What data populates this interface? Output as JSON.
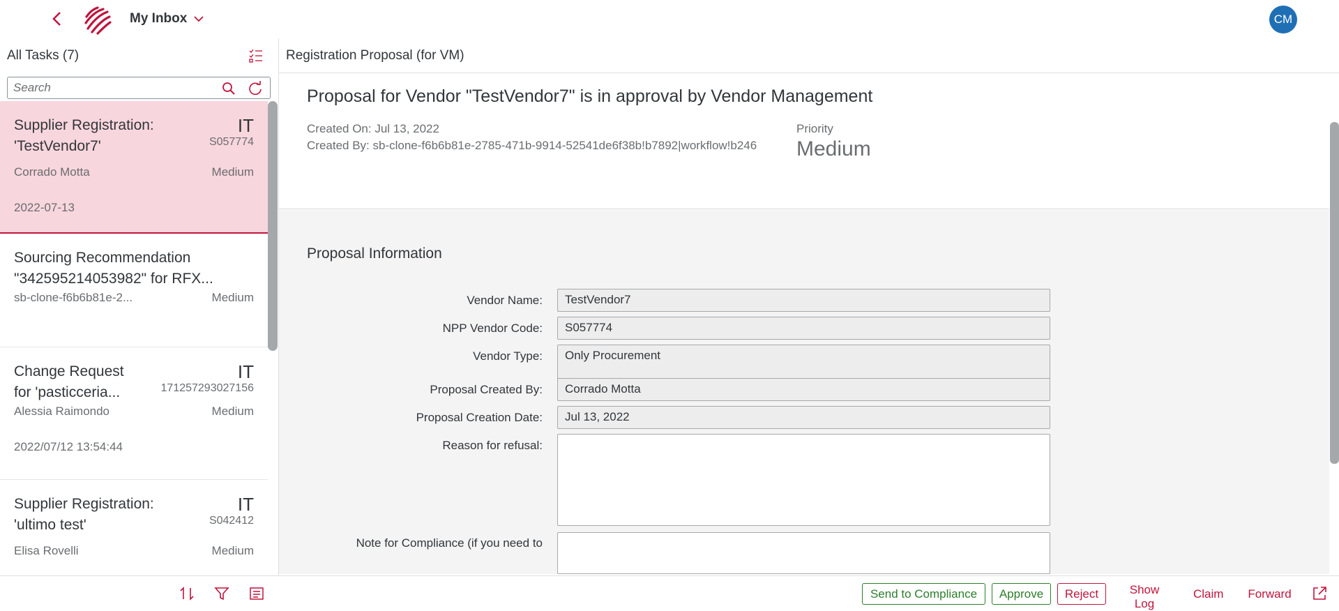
{
  "shell": {
    "title": "My Inbox",
    "avatar_initials": "CM",
    "accent_color": "#c0143c",
    "avatar_color": "#1f6fb5"
  },
  "master": {
    "title": "All Tasks (7)",
    "search_placeholder": "Search",
    "items": [
      {
        "title": "Supplier Registration: 'TestVendor7'",
        "number": "IT",
        "unit": "S057774",
        "attribute": "Corrado Motta",
        "status": "Medium",
        "date": "2022-07-13",
        "selected": true
      },
      {
        "title": "Sourcing Recommendation \"342595214053982\" for RFX...",
        "number": "",
        "unit": "",
        "attribute": "sb-clone-f6b6b81e-2...",
        "status": "Medium",
        "date": ""
      },
      {
        "title": "Change Request for 'pasticceria...",
        "number": "IT",
        "unit": "171257293027156",
        "attribute": "Alessia Raimondo",
        "status": "Medium",
        "date": "2022/07/12 13:54:44"
      },
      {
        "title": "Supplier Registration: 'ultimo test'",
        "number": "IT",
        "unit": "S042412",
        "attribute": "Elisa Rovelli",
        "status": "Medium",
        "date": ""
      }
    ],
    "footer_icons": [
      "sort-icon",
      "filter-icon",
      "group-icon"
    ]
  },
  "detail": {
    "title": "Registration Proposal (for VM)",
    "object_title": "Proposal for Vendor \"TestVendor7\" is in approval by Vendor Management",
    "created_on": "Created On: Jul 13, 2022",
    "created_by": "Created By: sb-clone-f6b6b81e-2785-471b-9914-52541de6f38b!b7892|workflow!b246",
    "priority_label": "Priority",
    "priority_value": "Medium",
    "section_title": "Proposal Information",
    "fields": [
      {
        "label": "Vendor Name:",
        "value": "TestVendor7"
      },
      {
        "label": "NPP Vendor Code:",
        "value": "S057774"
      },
      {
        "label": "Vendor Type:",
        "value": "Only Procurement"
      },
      {
        "label": "Proposal Created By:",
        "value": "Corrado Motta"
      },
      {
        "label": "Proposal Creation Date:",
        "value": "Jul 13, 2022"
      },
      {
        "label": "Reason for refusal:",
        "value": ""
      },
      {
        "label": "Note for Compliance (if you need to",
        "value": ""
      }
    ],
    "actions": {
      "send_to_compliance": "Send to Compliance",
      "approve": "Approve",
      "reject": "Reject",
      "show_log": "Show Log",
      "claim": "Claim",
      "forward": "Forward"
    }
  }
}
